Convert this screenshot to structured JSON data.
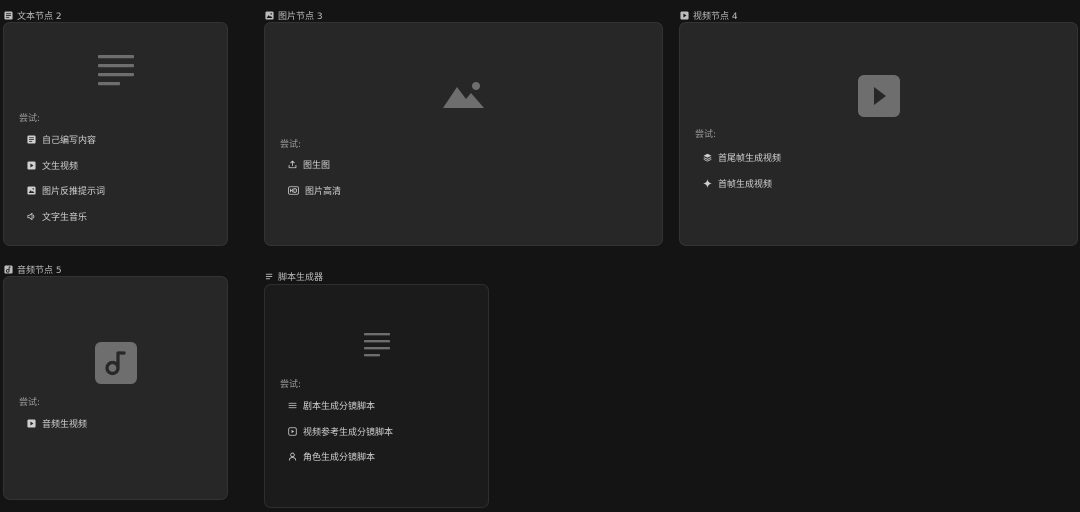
{
  "nodes": {
    "text": {
      "title": "文本节点 2",
      "try_label": "尝试:",
      "options": [
        "自己编写内容",
        "文生视频",
        "图片反推提示词",
        "文字生音乐"
      ]
    },
    "image": {
      "title": "图片节点 3",
      "try_label": "尝试:",
      "options": [
        "图生图",
        "图片高清"
      ]
    },
    "video": {
      "title": "视频节点 4",
      "try_label": "尝试:",
      "options": [
        "首尾帧生成视频",
        "首帧生成视频"
      ]
    },
    "audio": {
      "title": "音频节点 5",
      "try_label": "尝试:",
      "options": [
        "音频生视频"
      ]
    },
    "script": {
      "title": "脚本生成器",
      "try_label": "尝试:",
      "options": [
        "剧本生成分镜脚本",
        "视频参考生成分镜脚本",
        "角色生成分镜脚本"
      ]
    }
  },
  "icons": {
    "text_title": "text-doc-icon",
    "image_title": "image-icon",
    "video_title": "video-play-icon",
    "audio_title": "music-note-icon",
    "script_title": "lines-icon"
  },
  "colors": {
    "canvas_bg": "#141414",
    "card_bg": "#272727",
    "card_bg_dark": "#1b1b1b",
    "placeholder_icon": "#6e6e6e"
  }
}
